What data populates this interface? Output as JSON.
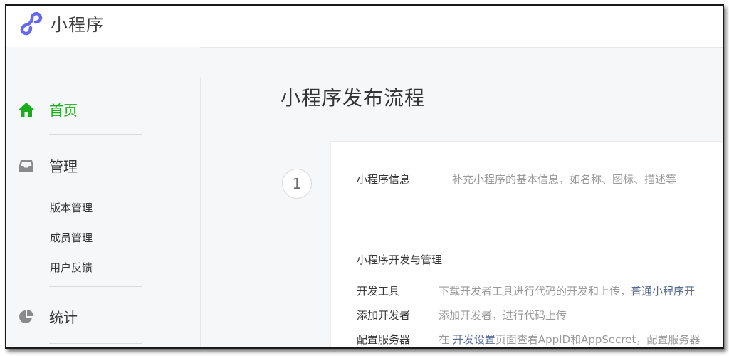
{
  "header": {
    "app_name": "小程序"
  },
  "sidebar": {
    "home": {
      "label": "首页",
      "icon": "home-icon"
    },
    "manage": {
      "label": "管理",
      "icon": "inbox-icon",
      "items": [
        "版本管理",
        "成员管理",
        "用户反馈"
      ]
    },
    "stats": {
      "label": "统计",
      "icon": "pie-chart-icon"
    }
  },
  "main": {
    "title": "小程序发布流程",
    "step": {
      "number": "1",
      "info_label": "小程序信息",
      "info_desc": "补充小程序的基本信息，如名称、图标、描述等",
      "section_title": "小程序开发与管理",
      "rows": [
        {
          "label": "开发工具",
          "desc": "下载开发者工具进行代码的开发和上传，",
          "link": "普通小程序开"
        },
        {
          "label": "添加开发者",
          "desc": "添加开发者，进行代码上传"
        },
        {
          "label": "配置服务器",
          "desc_prefix": "在",
          "link": "开发设置",
          "desc": "页面查看AppID和AppSecret，配置服务器"
        }
      ]
    }
  },
  "colors": {
    "accent_green": "#1aad19",
    "link_blue": "#576b95",
    "logo_purple": "#6467f0"
  }
}
